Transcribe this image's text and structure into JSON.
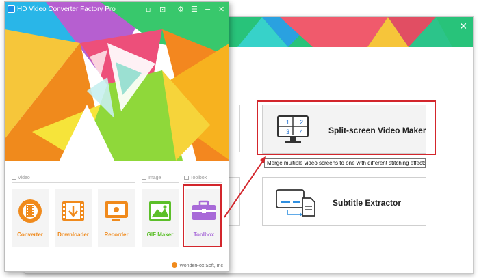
{
  "app": {
    "title": "HD Video Converter Factory Pro",
    "footer": "WonderFox Soft, Inc"
  },
  "sections": {
    "video": "Video",
    "image": "Image",
    "toolbox": "Toolbox"
  },
  "apps": [
    {
      "name": "Converter",
      "color": "#f08a1c"
    },
    {
      "name": "Downloader",
      "color": "#f08a1c"
    },
    {
      "name": "Recorder",
      "color": "#f08a1c"
    },
    {
      "name": "GIF Maker",
      "color": "#5cbf2a"
    },
    {
      "name": "Toolbox",
      "color": "#a86ad8"
    }
  ],
  "toolbox": {
    "split_screen": {
      "label": "Split-screen Video Maker",
      "cells": [
        "1",
        "2",
        "3",
        "4"
      ]
    },
    "subtitle": {
      "label": "Subtitle Extractor"
    },
    "tooltip": "Merge multiple video screens to one with different stitching effects."
  },
  "colors": {
    "accent": "#22c17a",
    "highlight": "#d3262c",
    "toolbox_purple": "#a86ad8",
    "orange": "#f08a1c",
    "green": "#5cbf2a"
  }
}
